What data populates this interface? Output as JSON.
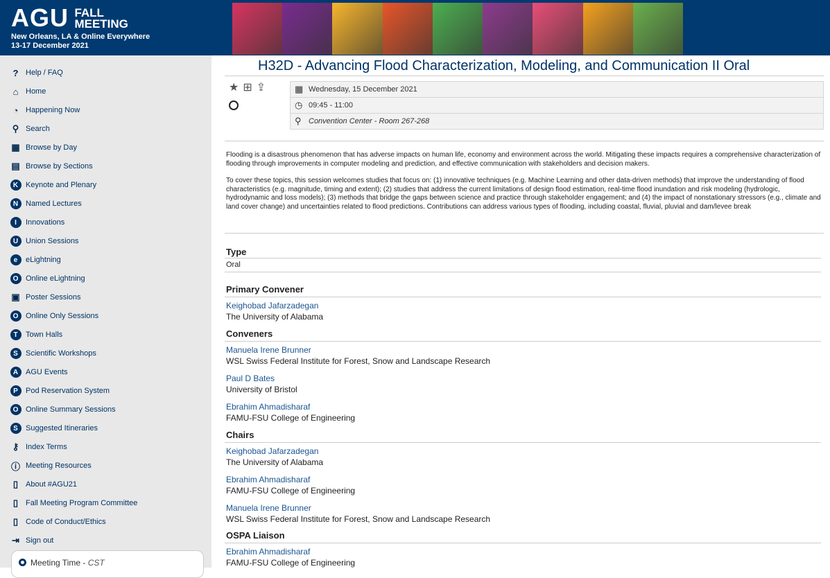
{
  "header": {
    "logo_agu": "AGU",
    "logo_fall": "FALL",
    "logo_meeting": "MEETING",
    "location": "New Orleans, LA & Online Everywhere",
    "dates": "13-17 December 2021",
    "banner_colors": [
      "#d8345f",
      "#7a2b8f",
      "#f7b52c",
      "#e8552a",
      "#4caf50",
      "#8e3b8e",
      "#e94e77",
      "#f4a11f",
      "#6ab04c"
    ]
  },
  "sidebar": {
    "items": [
      {
        "label": "Help / FAQ",
        "icon": "?"
      },
      {
        "label": "Home",
        "icon": "⌂"
      },
      {
        "label": "Happening Now",
        "icon": "◔"
      },
      {
        "label": "Search",
        "icon": "⚲"
      },
      {
        "label": "Browse by Day",
        "icon": "▦"
      },
      {
        "label": "Browse by Sections",
        "icon": "▤"
      },
      {
        "label": "Keynote and Plenary",
        "icon": "K"
      },
      {
        "label": "Named Lectures",
        "icon": "N"
      },
      {
        "label": "Innovations",
        "icon": "I"
      },
      {
        "label": "Union Sessions",
        "icon": "U"
      },
      {
        "label": "eLightning",
        "icon": "e"
      },
      {
        "label": "Online eLightning",
        "icon": "O"
      },
      {
        "label": "Poster Sessions",
        "icon": "▣"
      },
      {
        "label": "Online Only Sessions",
        "icon": "O"
      },
      {
        "label": "Town Halls",
        "icon": "T"
      },
      {
        "label": "Scientific Workshops",
        "icon": "S"
      },
      {
        "label": "AGU Events",
        "icon": "A"
      },
      {
        "label": "Pod Reservation System",
        "icon": "P"
      },
      {
        "label": "Online Summary Sessions",
        "icon": "O"
      },
      {
        "label": "Suggested Itineraries",
        "icon": "S"
      },
      {
        "label": "Index Terms",
        "icon": "⚷"
      },
      {
        "label": "Meeting Resources",
        "icon": "ⓘ"
      },
      {
        "label": "About #AGU21",
        "icon": "▯"
      },
      {
        "label": "Fall Meeting Program Committee",
        "icon": "▯"
      },
      {
        "label": "Code of Conduct/Ethics",
        "icon": "▯"
      },
      {
        "label": "Sign out",
        "icon": "⇥"
      }
    ],
    "meeting_time_label": "Meeting Time - ",
    "meeting_time_zone": "CST"
  },
  "session": {
    "title": "H32D - Advancing Flood Characterization, Modeling, and Communication II Oral",
    "date": "Wednesday, 15 December 2021",
    "time": "09:45 - 11:00",
    "location": "Convention Center - Room 267-268",
    "description_1": "Flooding is a disastrous phenomenon that has adverse impacts on human life, economy and environment across the world. Mitigating these impacts requires a comprehensive characterization of flooding through improvements in computer modeling and prediction, and effective communication with stakeholders and decision makers.",
    "description_2": "To cover these topics, this session welcomes studies that focus on: (1) innovative techniques (e.g. Machine Learning and other data-driven methods) that improve the understanding of flood characteristics (e.g. magnitude, timing and extent); (2) studies that address the current limitations of design flood estimation, real-time flood inundation and risk modeling (hydrologic, hydrodynamic and loss models); (3) methods that bridge the gaps between science and practice through stakeholder engagement; and (4) the impact of nonstationary stressors (e.g., climate and land cover change) and uncertainties related to flood predictions. Contributions can address various types of flooding, including coastal, fluvial, pluvial and dam/levee break",
    "type_heading": "Type",
    "type_value": "Oral",
    "primary_heading": "Primary Convener",
    "primary": [
      {
        "name": "Keighobad Jafarzadegan",
        "aff": "The University of Alabama"
      }
    ],
    "conveners_heading": "Conveners",
    "conveners": [
      {
        "name": "Manuela Irene Brunner",
        "aff": "WSL Swiss Federal Institute for Forest, Snow and Landscape Research"
      },
      {
        "name": "Paul D Bates",
        "aff": "University of Bristol"
      },
      {
        "name": "Ebrahim Ahmadisharaf",
        "aff": "FAMU-FSU College of Engineering"
      }
    ],
    "chairs_heading": "Chairs",
    "chairs": [
      {
        "name": "Keighobad Jafarzadegan",
        "aff": "The University of Alabama"
      },
      {
        "name": "Ebrahim Ahmadisharaf",
        "aff": "FAMU-FSU College of Engineering"
      },
      {
        "name": "Manuela Irene Brunner",
        "aff": "WSL Swiss Federal Institute for Forest, Snow and Landscape Research"
      }
    ],
    "ospa_heading": "OSPA Liaison",
    "ospa": [
      {
        "name": "Ebrahim Ahmadisharaf",
        "aff": "FAMU-FSU College of Engineering"
      }
    ]
  }
}
